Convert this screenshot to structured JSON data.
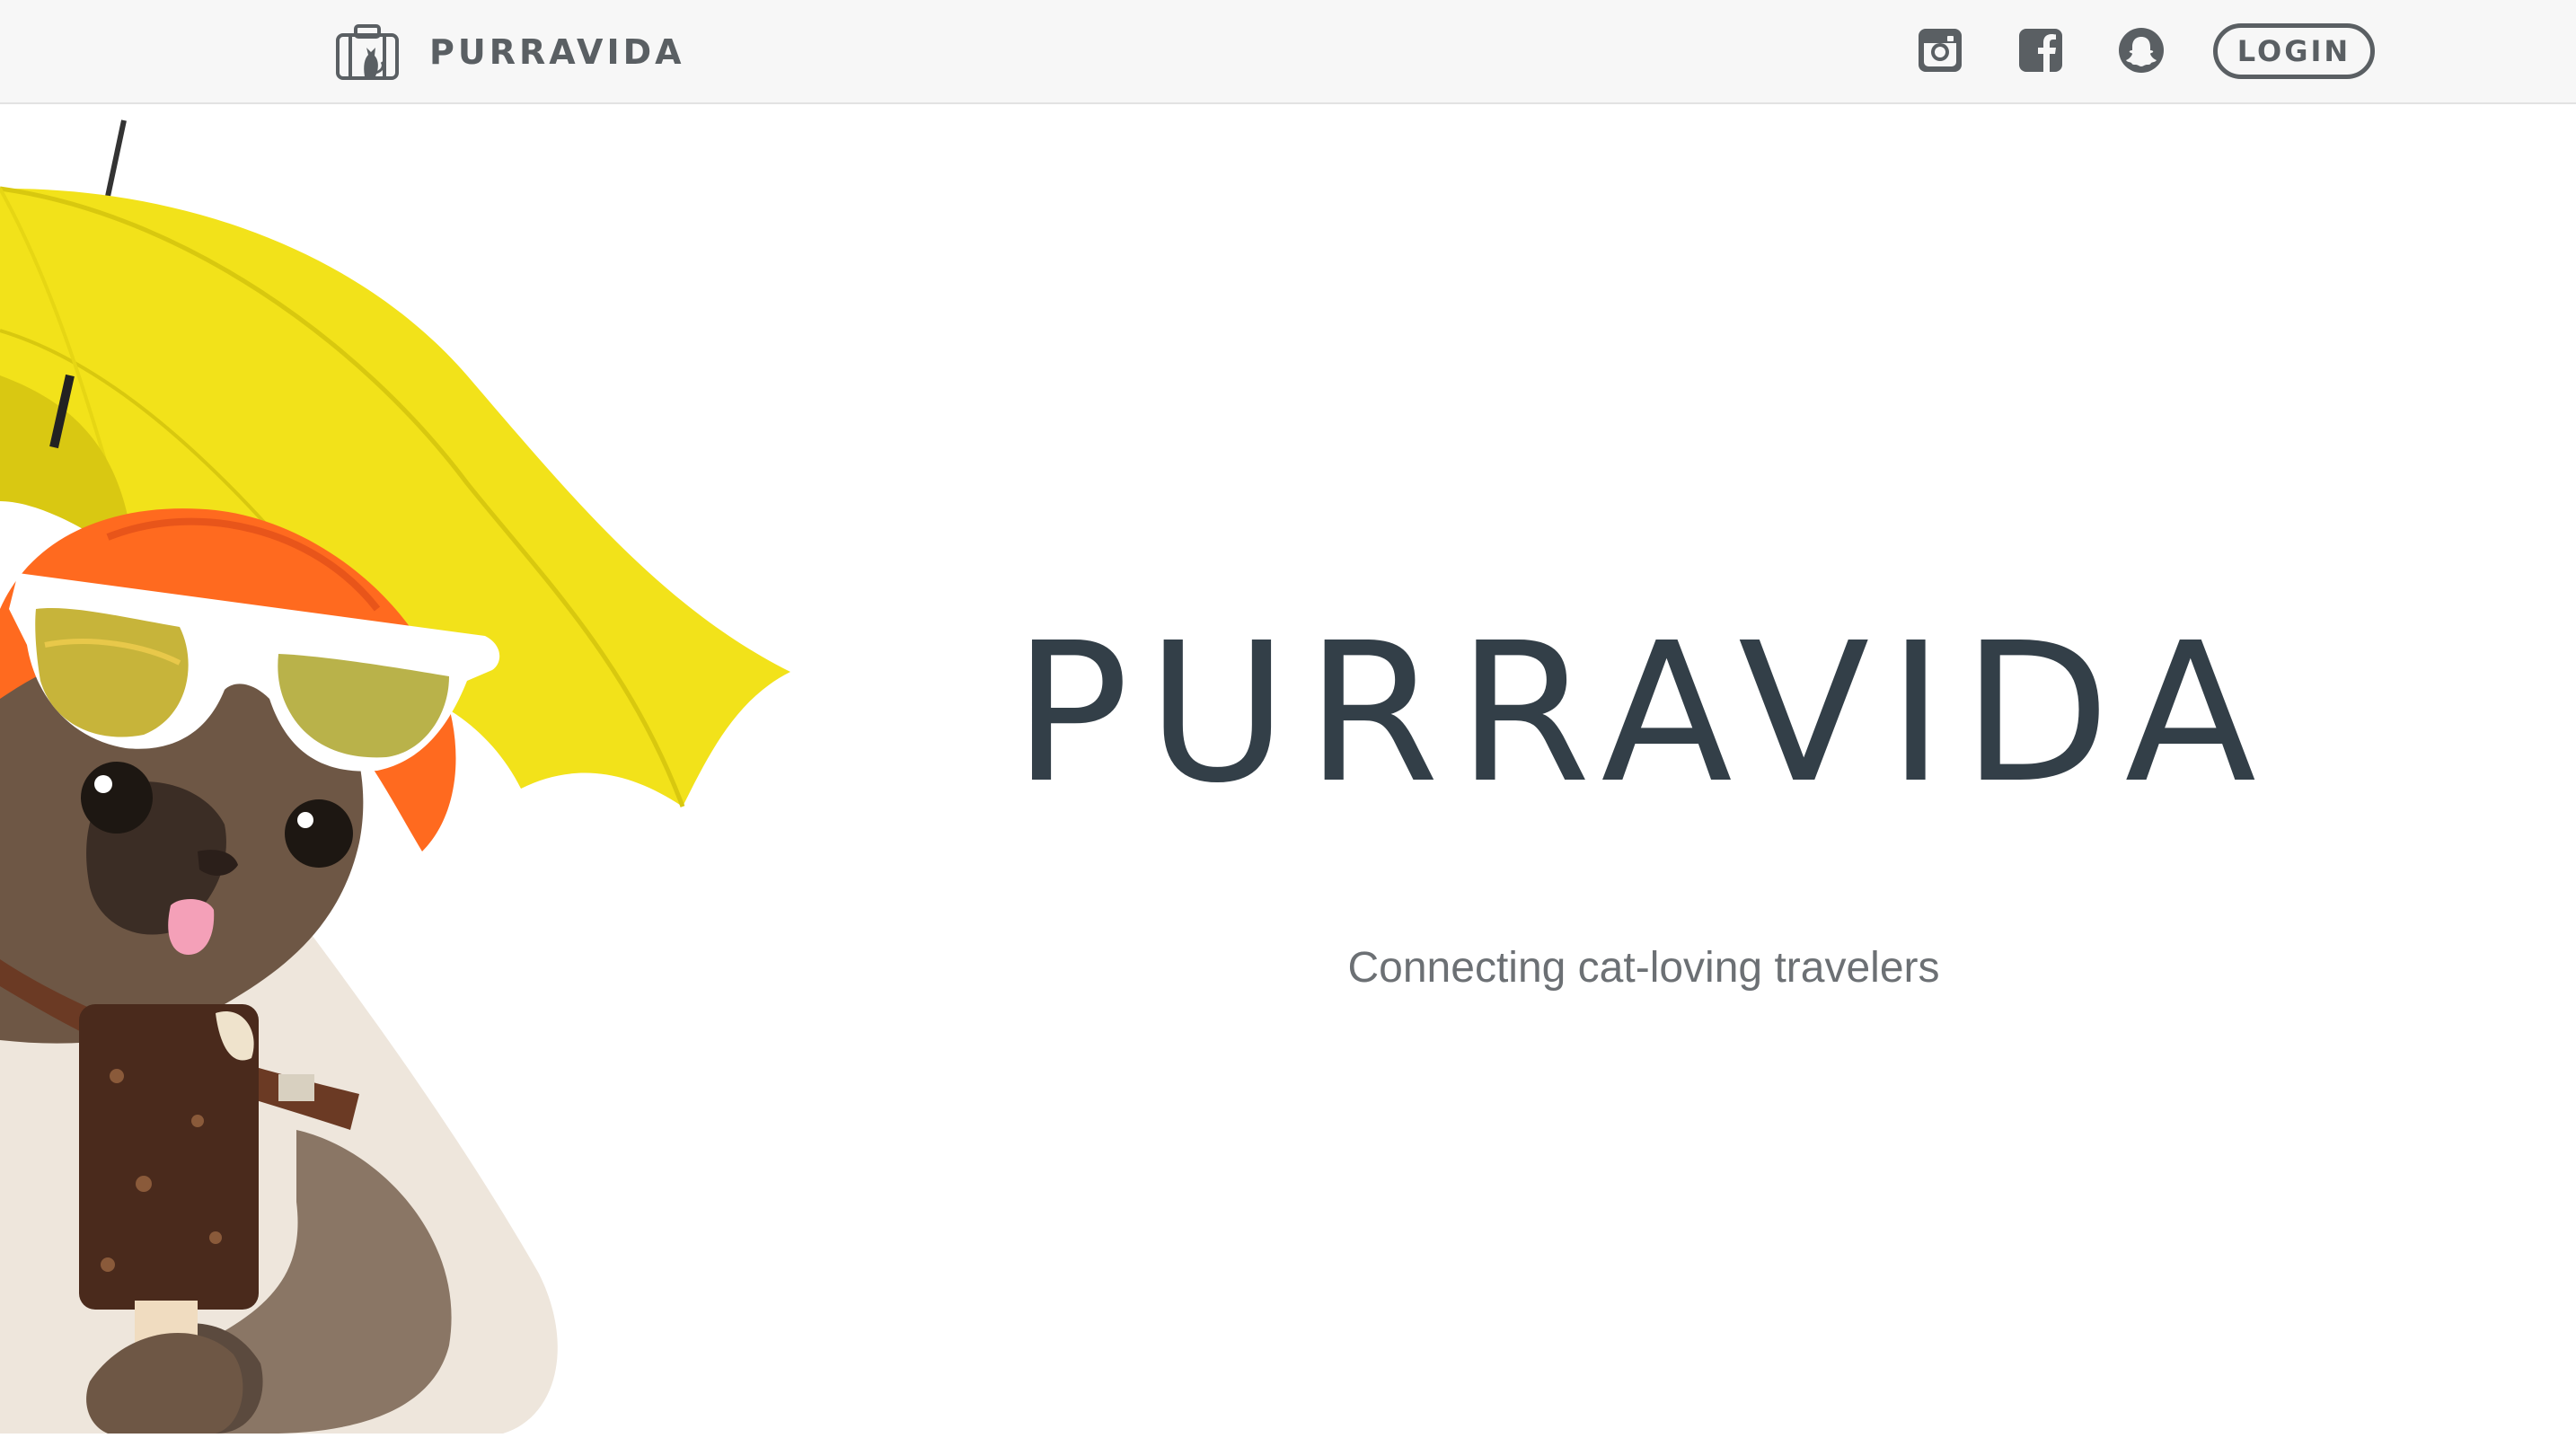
{
  "navbar": {
    "brand_name": "PURRAVIDA",
    "brand_logo_icon": "suitcase-cat-icon",
    "social_icons": [
      "instagram-icon",
      "facebook-icon",
      "snapchat-icon"
    ],
    "login_label": "LOGIN"
  },
  "hero": {
    "title": "PURRAVIDA",
    "subtitle": "Connecting cat-loving travelers",
    "illustration": "cat-with-umbrella-sunglasses-hat-icecream"
  },
  "colors": {
    "navbar_bg": "#f7f7f7",
    "nav_text": "#5a5f63",
    "title": "#333f48",
    "subtitle": "#6c7074",
    "umbrella": "#f2e21a",
    "hat": "#ff6a1f"
  }
}
